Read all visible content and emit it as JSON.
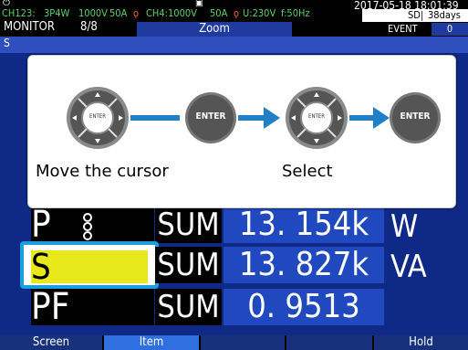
{
  "header": {
    "channels_a": "CH123:",
    "wiring": "3P4W",
    "voltage_a": "1000V",
    "current_a": "50A",
    "ch4": "CH4:1000V",
    "current_b": "50A",
    "u_info": "U:230V",
    "freq": "f:50Hz",
    "datetime": "2017-05-18 18:01:39",
    "sd_label": "SD",
    "days": "38days",
    "event_label": "EVENT",
    "event_count": "0",
    "mode": "MONITOR",
    "page": "8/8",
    "tab_title": "Zoom"
  },
  "overlay": {
    "enter_label_1": "ENTER",
    "enter_label_2": "ENTER",
    "enter_label_3": "ENTER",
    "enter_label_4": "ENTER",
    "caption_move": "Move the cursor",
    "caption_select": "Select"
  },
  "rows": [
    {
      "label": "P",
      "sum": "SUM",
      "value": "13. 154k",
      "unit": "W"
    },
    {
      "label": "S",
      "sum": "SUM",
      "value": "13. 827k",
      "unit": "VA"
    },
    {
      "label": "PF",
      "sum": "SUM",
      "value": "0. 9513",
      "unit": ""
    }
  ],
  "footer": {
    "screen": "Screen",
    "item": "Item",
    "hold": "Hold"
  },
  "colors": {
    "main_bg": "#0e2a86",
    "value_bg": "#2149bf",
    "highlight": "#e8e81a",
    "accent": "#1aa0e0",
    "header_green": "#5ad36c"
  }
}
